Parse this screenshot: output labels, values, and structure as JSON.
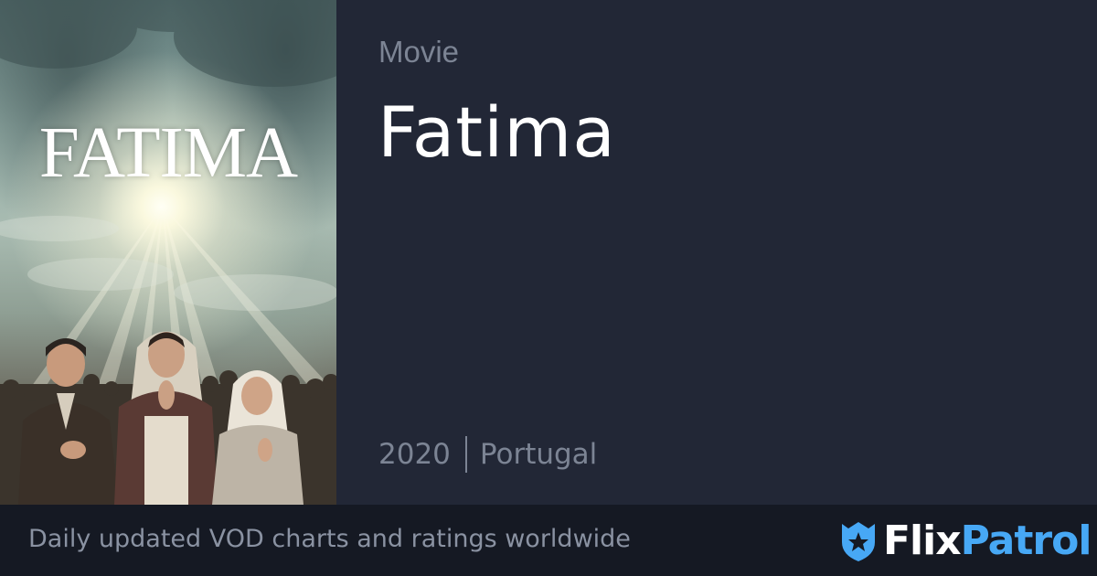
{
  "poster": {
    "title_text": "FATIMA"
  },
  "info": {
    "type_label": "Movie",
    "title": "Fatima",
    "year": "2020",
    "country": "Portugal"
  },
  "footer": {
    "tagline": "Daily updated VOD charts and ratings worldwide",
    "brand_part1": "Flix",
    "brand_part2": "Patrol",
    "icon": "shield-star-icon"
  },
  "colors": {
    "background": "#222736",
    "footer_background": "#151923",
    "muted_text": "#7c8494",
    "brand_blue": "#47a8f5",
    "title_text": "#ffffff"
  }
}
